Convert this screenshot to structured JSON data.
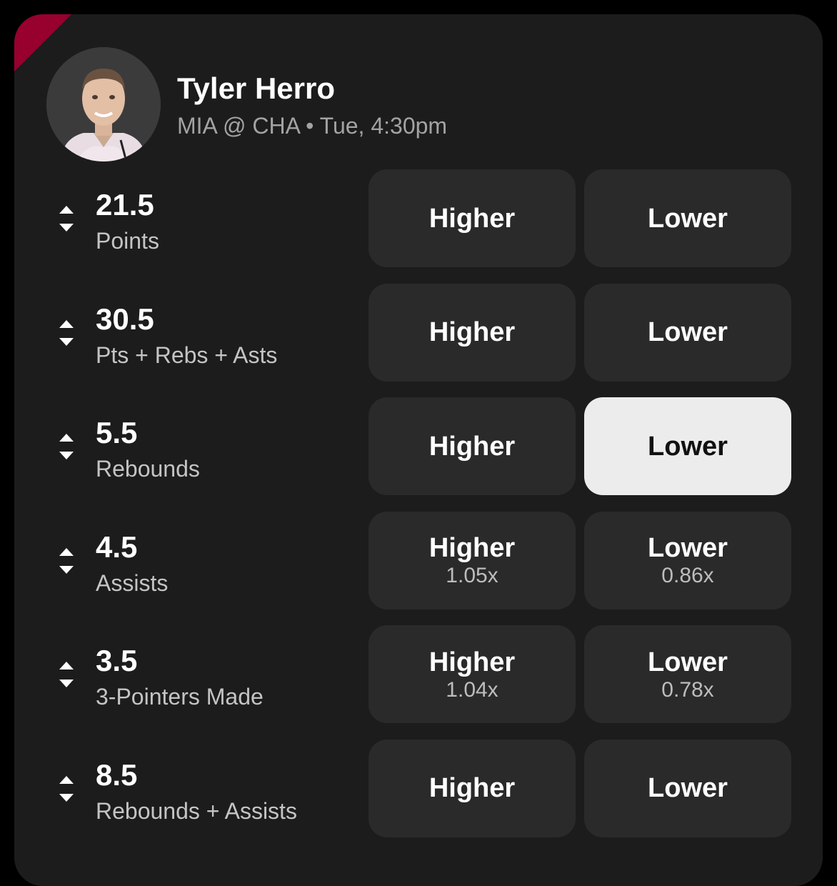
{
  "player": {
    "name": "Tyler Herro",
    "game_info": "MIA @ CHA • Tue, 4:30pm",
    "team_color": "#98002e"
  },
  "higher_label": "Higher",
  "lower_label": "Lower",
  "props": [
    {
      "line": "21.5",
      "stat": "Points",
      "higher_mult": "",
      "lower_mult": "",
      "selected": ""
    },
    {
      "line": "30.5",
      "stat": "Pts + Rebs + Asts",
      "higher_mult": "",
      "lower_mult": "",
      "selected": ""
    },
    {
      "line": "5.5",
      "stat": "Rebounds",
      "higher_mult": "",
      "lower_mult": "",
      "selected": "lower"
    },
    {
      "line": "4.5",
      "stat": "Assists",
      "higher_mult": "1.05x",
      "lower_mult": "0.86x",
      "selected": ""
    },
    {
      "line": "3.5",
      "stat": "3-Pointers Made",
      "higher_mult": "1.04x",
      "lower_mult": "0.78x",
      "selected": ""
    },
    {
      "line": "8.5",
      "stat": "Rebounds + Assists",
      "higher_mult": "",
      "lower_mult": "",
      "selected": ""
    }
  ]
}
